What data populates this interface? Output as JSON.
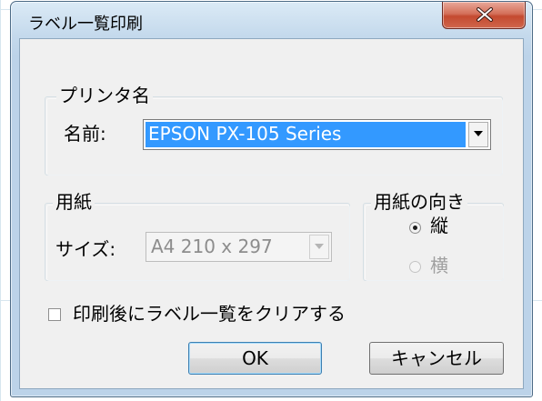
{
  "window": {
    "title": "ラベル一覧印刷",
    "close_glyph": "X"
  },
  "printer": {
    "group_label": "プリンタ名",
    "name_label": "名前:",
    "selected_value": "EPSON PX-105 Series"
  },
  "paper": {
    "group_label": "用紙",
    "size_label": "サイズ:",
    "size_value": "A4 210 x 297"
  },
  "orientation": {
    "group_label": "用紙の向き",
    "options": [
      {
        "label": "縦",
        "selected": true,
        "enabled": true
      },
      {
        "label": "横",
        "selected": false,
        "enabled": false
      }
    ]
  },
  "clear_after_print": {
    "label": "印刷後にラベル一覧をクリアする",
    "checked": false
  },
  "buttons": {
    "ok_label": "OK",
    "cancel_label": "キャンセル"
  },
  "colors": {
    "selection": "#3399ff",
    "close_button": "#c44a30",
    "title_bar": "#c4d9ec"
  }
}
